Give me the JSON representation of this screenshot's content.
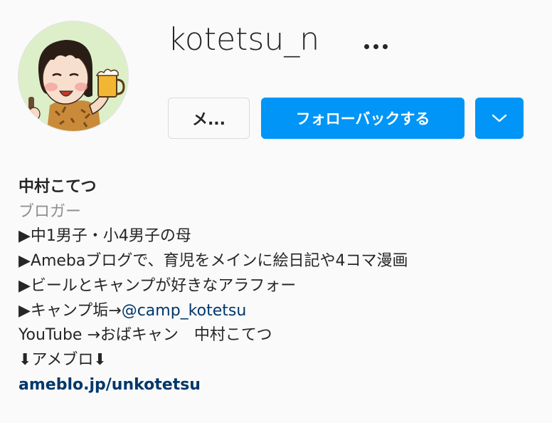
{
  "profile": {
    "username": "kotetsu_n",
    "more_icon": "more-horizontal-icon"
  },
  "actions": {
    "message_label": "メ...",
    "follow_back_label": "フォローバックする",
    "dropdown_icon": "chevron-down-icon"
  },
  "bio": {
    "name": "中村こてつ",
    "category": "ブロガー",
    "lines": [
      "▶中1男子・小4男子の母",
      "▶Amebaブログで、育児をメインに絵日記や4コマ漫画",
      "▶ビールとキャンプが好きなアラフォー"
    ],
    "camp_prefix": "▶キャンプ垢→",
    "camp_mention": "@camp_kotetsu",
    "youtube": "YouTube →おばキャン　中村こてつ",
    "ameblo": "⬇アメブロ⬇",
    "link": "ameblo.jp/unkotetsu"
  },
  "colors": {
    "accent": "#0095f6",
    "link": "#00376b",
    "muted": "#8e8e8e"
  }
}
